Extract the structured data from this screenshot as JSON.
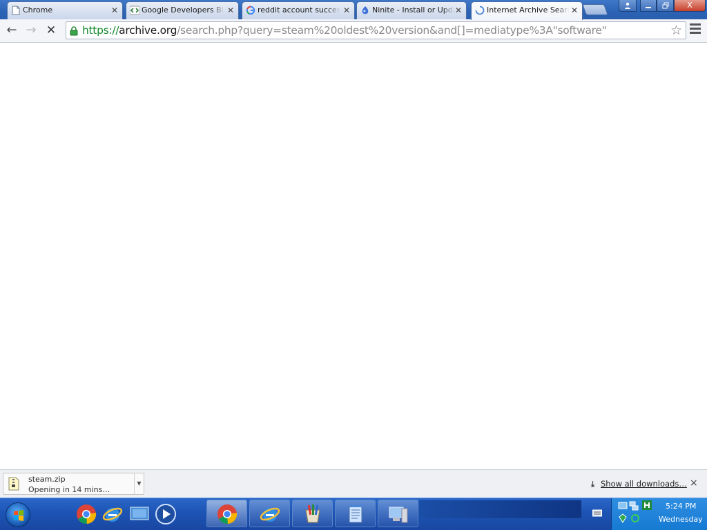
{
  "tabs": [
    {
      "title": "Chrome",
      "icon": "document-icon",
      "active": false
    },
    {
      "title": "Google Developers Blog",
      "icon": "code-brackets-icon",
      "active": false
    },
    {
      "title": "reddit account successfully created",
      "icon": "google-g-icon",
      "active": false
    },
    {
      "title": "Ninite - Install or Update",
      "icon": "ninite-icon",
      "active": false
    },
    {
      "title": "Internet Archive Search",
      "icon": "loading-spinner-icon",
      "active": true
    }
  ],
  "window_controls": {
    "user": "user-icon",
    "minimize": "minimize-icon",
    "maximize": "restore-icon",
    "close": "X"
  },
  "toolbar": {
    "url_scheme": "https://",
    "url_host": "archive.org",
    "url_path": "/search.php?query=steam%20oldest%20version&and[]=mediatype%3A\"software\"",
    "back_icon": "←",
    "forward_icon": "→",
    "stop_icon": "✕",
    "star_icon": "☆"
  },
  "downloads": {
    "item_name": "steam.zip",
    "item_status": "Opening in 14 mins…",
    "show_all_label": "Show all downloads…",
    "close_label": "×"
  },
  "taskbar": {
    "quick_launch": [
      "chrome-icon",
      "internet-explorer-icon",
      "show-desktop-icon",
      "media-player-icon"
    ],
    "buttons": [
      "chrome-icon",
      "internet-explorer-icon",
      "paint-icon",
      "notepad-icon",
      "computer-icon"
    ],
    "clock_time": "5:24 PM",
    "clock_day": "Wednesday"
  },
  "colors": {
    "taskbar": "#1d54b4",
    "tabstrip": "#2b63b5",
    "url_scheme": "#138a2e"
  }
}
